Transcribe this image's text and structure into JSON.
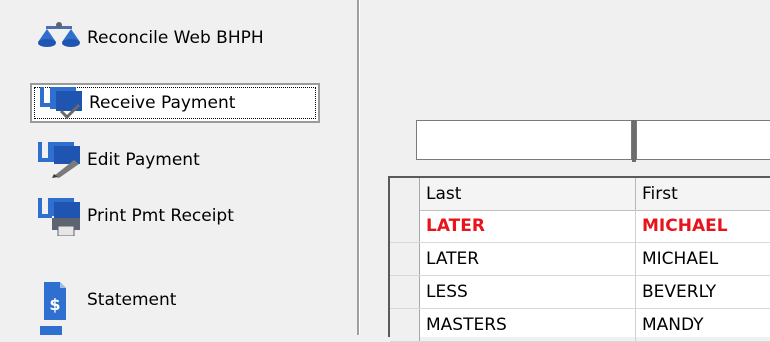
{
  "nav": {
    "reconcile_label": "Reconcile Web BHPH",
    "receive_label": "Receive Payment",
    "edit_label": "Edit Payment",
    "print_label": "Print Pmt Receipt",
    "statement_label": "Statement"
  },
  "grid": {
    "columns": [
      "Last",
      "First"
    ],
    "rows": [
      {
        "last": "LATER",
        "first": "MICHAEL",
        "highlighted": true
      },
      {
        "last": "LATER",
        "first": "MICHAEL"
      },
      {
        "last": "LESS",
        "first": "BEVERLY"
      },
      {
        "last": "MASTERS",
        "first": "MANDY"
      }
    ]
  },
  "colors": {
    "highlight_text": "#e8141b",
    "icon_blue": "#2f6fcf",
    "icon_gray": "#5c6470"
  }
}
